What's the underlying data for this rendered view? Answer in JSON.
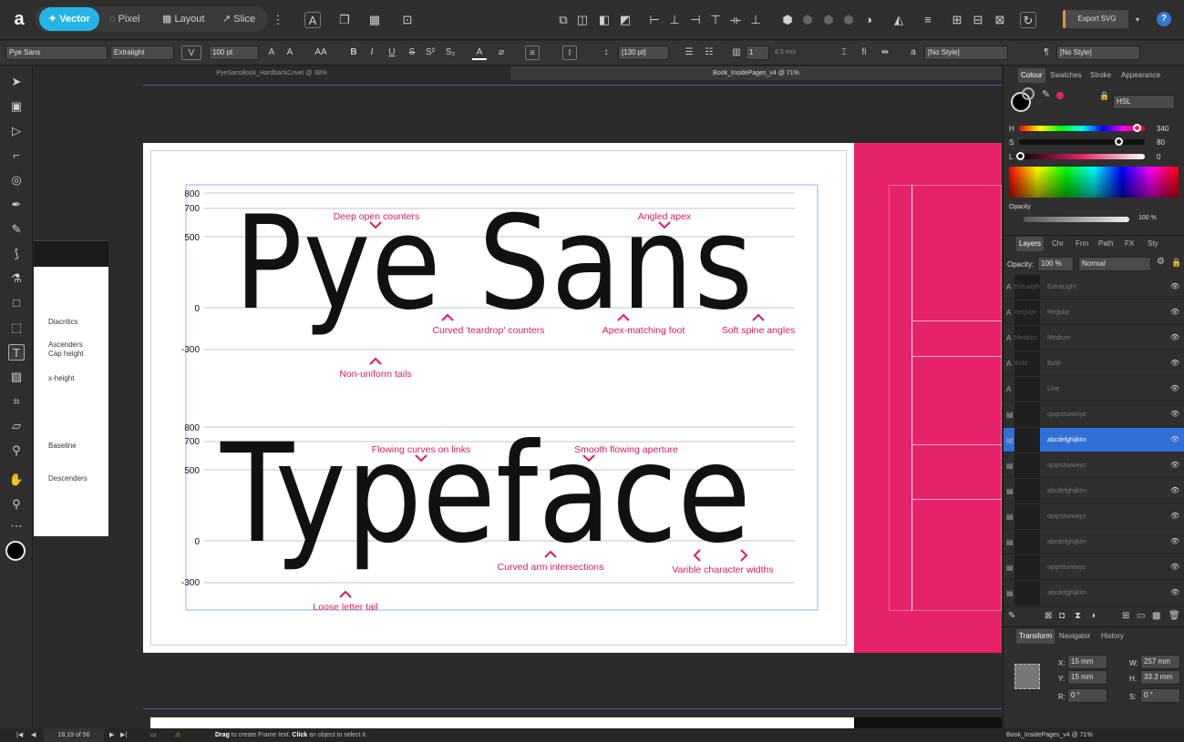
{
  "toolbar": {
    "personas": [
      "Vector",
      "Pixel",
      "Layout",
      "Slice"
    ],
    "export_label": "Export SVG",
    "help_label": "?"
  },
  "context": {
    "font": "Pye Sans",
    "weight": "Extralight",
    "size": "100 pt",
    "leading": "[130 pt]",
    "columns": "1",
    "gutter": "8.5 mm",
    "char_style": "[No Style]",
    "para_style": "[No Style]"
  },
  "tabs": [
    "PyeSansBook_HardbackCover @ 38%",
    "Book_InsidePages_v4 @ 71%"
  ],
  "canvas": {
    "guide_labels": [
      "Diacritics",
      "Ascenders",
      "Cap height",
      "x-height",
      "Baseline",
      "Descenders"
    ],
    "word1": "Pye Sans",
    "word2": "Typeface",
    "ticks1": [
      "800",
      "700",
      "500",
      "0",
      "-300"
    ],
    "ticks2": [
      "800",
      "700",
      "500",
      "0",
      "-300"
    ],
    "annotations": [
      "Deep open counters",
      "Angled apex",
      "Curved 'teardrop' counters",
      "Apex-matching foot",
      "Soft spine angles",
      "Non-uniform tails",
      "Flowing curves on links",
      "Smooth flowing aperture",
      "Curved arm intersections",
      "Varible character widths",
      "Loose letter tail"
    ]
  },
  "colour_panel": {
    "tabs": [
      "Colour",
      "Swatches",
      "Stroke",
      "Appearance"
    ],
    "model": "HSL",
    "h_label": "H",
    "h_value": "340",
    "s_label": "S",
    "s_value": "80",
    "l_label": "L",
    "l_value": "0",
    "opacity_label": "Opacity",
    "opacity_value": "100 %",
    "h": 340,
    "s": 80,
    "l": 0
  },
  "layers_panel": {
    "tabs": [
      "Layers",
      "Chr",
      "Frm",
      "Path",
      "FX",
      "Sty"
    ],
    "opacity_label": "Opacity:",
    "opacity": "100 %",
    "blend": "Normal",
    "rows": [
      {
        "name": "ExtraLight",
        "thumb": "Extralight"
      },
      {
        "name": "Regular",
        "thumb": "Regular"
      },
      {
        "name": "Medium",
        "thumb": "Medium"
      },
      {
        "name": "Bold",
        "thumb": "Bold"
      },
      {
        "name": "Line",
        "thumb": ""
      },
      {
        "name": "opqrstuvwxyz",
        "thumb": ""
      },
      {
        "name": "abcdefghijklm",
        "thumb": ""
      },
      {
        "name": "opqrstuvwxyz",
        "thumb": ""
      },
      {
        "name": "abcdefghijklm",
        "thumb": ""
      },
      {
        "name": "opqrstuvwxyz",
        "thumb": ""
      },
      {
        "name": "abcdefghijklm",
        "thumb": ""
      },
      {
        "name": "opqrstuvwxyz",
        "thumb": ""
      },
      {
        "name": "abcdefghijklm",
        "thumb": ""
      }
    ],
    "selected_index": 6
  },
  "transform_panel": {
    "tabs": [
      "Transform",
      "Navigator",
      "History"
    ],
    "x_label": "X:",
    "x": "15 mm",
    "y_label": "Y:",
    "y": "15 mm",
    "w_label": "W:",
    "w": "257 mm",
    "h_label": "H:",
    "h": "33.3 mm",
    "r_label": "R:",
    "r": "0 °",
    "s_label": "S:",
    "s": "0 °"
  },
  "status": {
    "page": "18,19 of 56",
    "hint_bold1": "Drag",
    "hint_mid": " to create Frame text. ",
    "hint_bold2": "Click",
    "hint_end": " an object to select it.",
    "doc": "Book_InsidePages_v4 @ 71%"
  },
  "colors": {
    "accent": "#e6236a",
    "persona_active": "#24b4e6",
    "selection": "#2f6fd6"
  }
}
